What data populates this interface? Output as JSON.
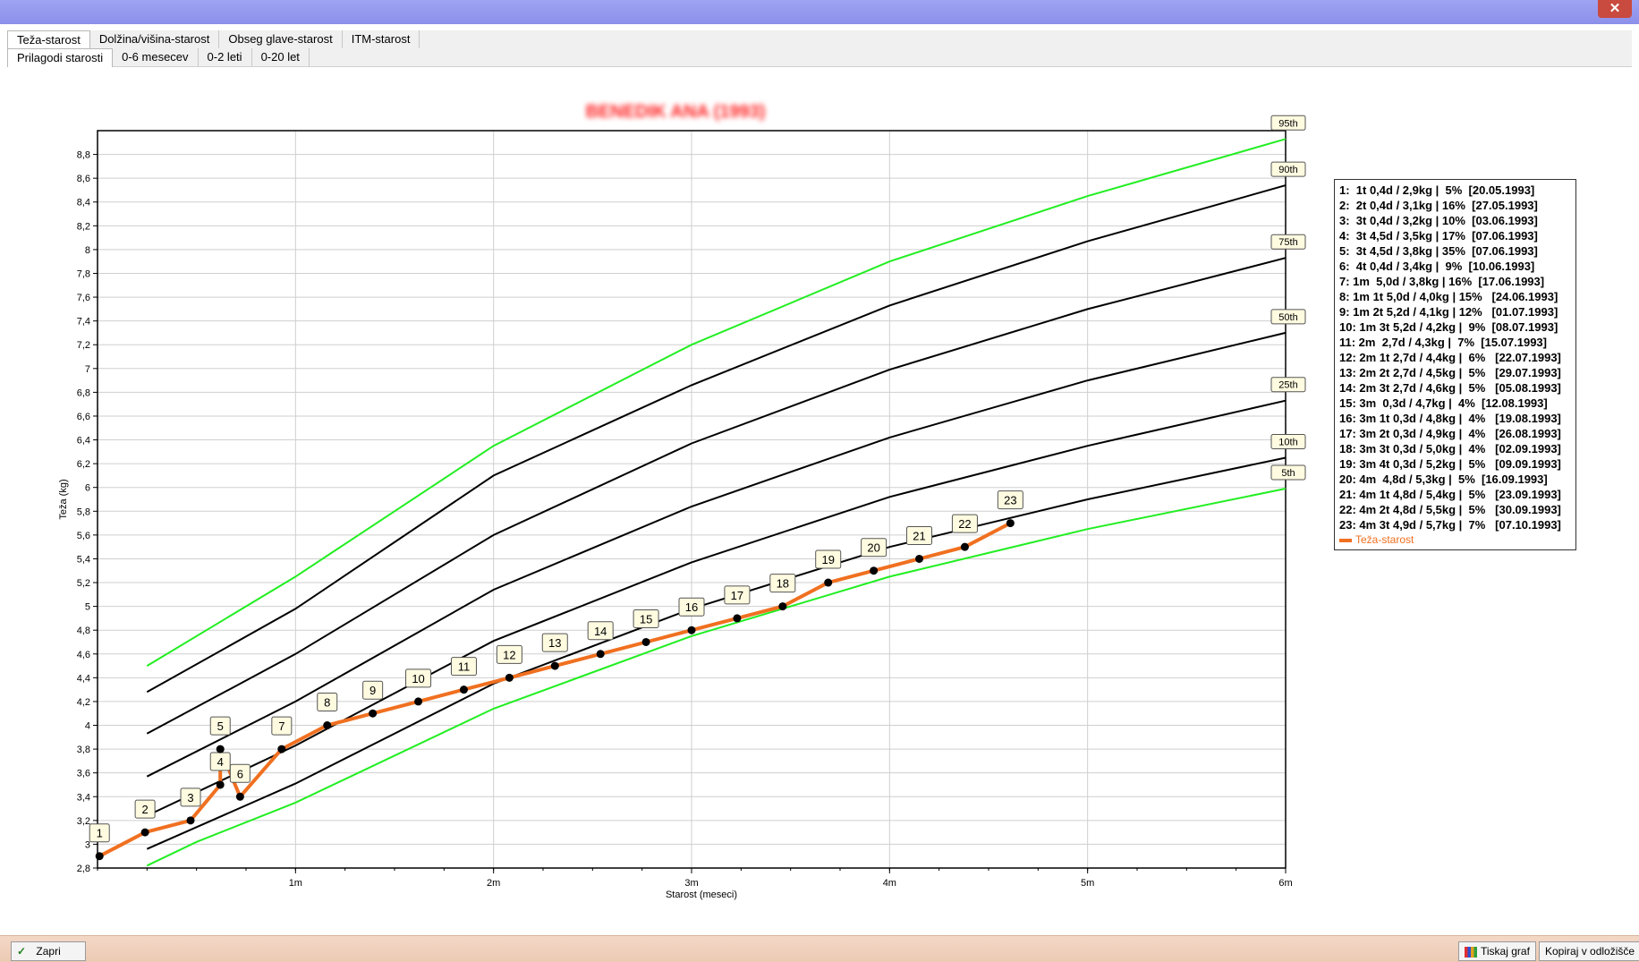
{
  "window": {
    "close_glyph": "✕"
  },
  "tabs_row1": [
    "Teža-starost",
    "Dolžina/višina-starost",
    "Obseg glave-starost",
    "ITM-starost"
  ],
  "tabs_row2": [
    "Prilagodi starosti",
    "0-6 mesecev",
    "0-2 leti",
    "0-20 let"
  ],
  "buttons": {
    "close": "Zapri",
    "print": "Tiskaj graf",
    "copy": "Kopiraj v odložišče"
  },
  "colors": {
    "series": "#f07020",
    "green_percentile": "#22ee22",
    "black_percentile": "#000000",
    "title": "#ff2020"
  },
  "chart_data": {
    "type": "line",
    "title": "BENEDIK ANA (1993)",
    "xlabel": "Starost (meseci)",
    "ylabel": "Teža (kg)",
    "xlim": [
      0,
      6
    ],
    "ylim": [
      2.8,
      9.0
    ],
    "x_tick_labels": [
      "1m",
      "2m",
      "3m",
      "4m",
      "5m",
      "6m"
    ],
    "x_ticks": [
      1,
      2,
      3,
      4,
      5,
      6
    ],
    "y_ticks": [
      2.8,
      3.0,
      3.2,
      3.4,
      3.6,
      3.8,
      4.0,
      4.2,
      4.4,
      4.6,
      4.8,
      5.0,
      5.2,
      5.4,
      5.6,
      5.8,
      6.0,
      6.2,
      6.4,
      6.6,
      6.8,
      7.0,
      7.2,
      7.4,
      7.6,
      7.8,
      8.0,
      8.2,
      8.4,
      8.6,
      8.8
    ],
    "y_tick_labels": [
      "2,8",
      "3",
      "3,2",
      "3,4",
      "3,6",
      "3,8",
      "4",
      "4,2",
      "4,4",
      "4,6",
      "4,8",
      "5",
      "5,2",
      "5,4",
      "5,6",
      "5,8",
      "6",
      "6,2",
      "6,4",
      "6,6",
      "6,8",
      "7",
      "7,2",
      "7,4",
      "7,6",
      "7,8",
      "8",
      "8,2",
      "8,4",
      "8,6",
      "8,8"
    ],
    "grid": true,
    "legend_position": "right",
    "percentiles": [
      {
        "name": "95th",
        "color": "#22ee22",
        "x": [
          0.25,
          1,
          2,
          3,
          4,
          5,
          6
        ],
        "y": [
          4.5,
          5.25,
          6.35,
          7.2,
          7.9,
          8.45,
          8.93
        ]
      },
      {
        "name": "90th",
        "color": "#000000",
        "x": [
          0.25,
          1,
          2,
          3,
          4,
          5,
          6
        ],
        "y": [
          4.28,
          4.98,
          6.1,
          6.86,
          7.53,
          8.07,
          8.54
        ]
      },
      {
        "name": "75th",
        "color": "#000000",
        "x": [
          0.25,
          1,
          2,
          3,
          4,
          5,
          6
        ],
        "y": [
          3.93,
          4.6,
          5.6,
          6.37,
          6.99,
          7.5,
          7.93
        ]
      },
      {
        "name": "50th",
        "color": "#000000",
        "x": [
          0.25,
          1,
          2,
          3,
          4,
          5,
          6
        ],
        "y": [
          3.57,
          4.2,
          5.14,
          5.84,
          6.42,
          6.9,
          7.3
        ]
      },
      {
        "name": "25th",
        "color": "#000000",
        "x": [
          0.25,
          1,
          2,
          3,
          4,
          5,
          6
        ],
        "y": [
          3.24,
          3.83,
          4.71,
          5.37,
          5.92,
          6.35,
          6.73
        ]
      },
      {
        "name": "10th",
        "color": "#000000",
        "x": [
          0.25,
          1,
          2,
          3,
          4,
          5,
          6
        ],
        "y": [
          2.96,
          3.51,
          4.35,
          4.98,
          5.5,
          5.9,
          6.25
        ]
      },
      {
        "name": "5th",
        "color": "#22ee22",
        "x": [
          0.25,
          0.5,
          1,
          2,
          3,
          4,
          5,
          6
        ],
        "y": [
          2.82,
          3.02,
          3.35,
          4.14,
          4.75,
          5.25,
          5.65,
          5.99
        ]
      }
    ],
    "series": [
      {
        "name": "Teža-starost",
        "color": "#f07020",
        "points": [
          {
            "label": "1",
            "x": 0.01,
            "y": 2.9
          },
          {
            "label": "2",
            "x": 0.24,
            "y": 3.1
          },
          {
            "label": "3",
            "x": 0.47,
            "y": 3.2
          },
          {
            "label": "4",
            "x": 0.62,
            "y": 3.5
          },
          {
            "label": "5",
            "x": 0.62,
            "y": 3.8
          },
          {
            "label": "6",
            "x": 0.72,
            "y": 3.4
          },
          {
            "label": "7",
            "x": 0.93,
            "y": 3.8
          },
          {
            "label": "8",
            "x": 1.16,
            "y": 4.0
          },
          {
            "label": "9",
            "x": 1.39,
            "y": 4.1
          },
          {
            "label": "10",
            "x": 1.62,
            "y": 4.2
          },
          {
            "label": "11",
            "x": 1.85,
            "y": 4.3
          },
          {
            "label": "12",
            "x": 2.08,
            "y": 4.4
          },
          {
            "label": "13",
            "x": 2.31,
            "y": 4.5
          },
          {
            "label": "14",
            "x": 2.54,
            "y": 4.6
          },
          {
            "label": "15",
            "x": 2.77,
            "y": 4.7
          },
          {
            "label": "16",
            "x": 3.0,
            "y": 4.8
          },
          {
            "label": "17",
            "x": 3.23,
            "y": 4.9
          },
          {
            "label": "18",
            "x": 3.46,
            "y": 5.0
          },
          {
            "label": "19",
            "x": 3.69,
            "y": 5.2
          },
          {
            "label": "20",
            "x": 3.92,
            "y": 5.3
          },
          {
            "label": "21",
            "x": 4.15,
            "y": 5.4
          },
          {
            "label": "22",
            "x": 4.38,
            "y": 5.5
          },
          {
            "label": "23",
            "x": 4.61,
            "y": 5.7
          }
        ]
      }
    ],
    "legend_entries": [
      "1:  1t 0,4d / 2,9kg |  5%  [20.05.1993]",
      "2:  2t 0,4d / 3,1kg | 16%  [27.05.1993]",
      "3:  3t 0,4d / 3,2kg | 10%  [03.06.1993]",
      "4:  3t 4,5d / 3,5kg | 17%  [07.06.1993]",
      "5:  3t 4,5d / 3,8kg | 35%  [07.06.1993]",
      "6:  4t 0,4d / 3,4kg |  9%  [10.06.1993]",
      "7: 1m  5,0d / 3,8kg | 16%  [17.06.1993]",
      "8: 1m 1t 5,0d / 4,0kg | 15%   [24.06.1993]",
      "9: 1m 2t 5,2d / 4,1kg | 12%   [01.07.1993]",
      "10: 1m 3t 5,2d / 4,2kg |  9%  [08.07.1993]",
      "11: 2m  2,7d / 4,3kg |  7%  [15.07.1993]",
      "12: 2m 1t 2,7d / 4,4kg |  6%   [22.07.1993]",
      "13: 2m 2t 2,7d / 4,5kg |  5%   [29.07.1993]",
      "14: 2m 3t 2,7d / 4,6kg |  5%   [05.08.1993]",
      "15: 3m  0,3d / 4,7kg |  4%  [12.08.1993]",
      "16: 3m 1t 0,3d / 4,8kg |  4%   [19.08.1993]",
      "17: 3m 2t 0,3d / 4,9kg |  4%   [26.08.1993]",
      "18: 3m 3t 0,3d / 5,0kg |  4%   [02.09.1993]",
      "19: 3m 4t 0,3d / 5,2kg |  5%   [09.09.1993]",
      "20: 4m  4,8d / 5,3kg |  5%  [16.09.1993]",
      "21: 4m 1t 4,8d / 5,4kg |  5%   [23.09.1993]",
      "22: 4m 2t 4,8d / 5,5kg |  5%   [30.09.1993]",
      "23: 4m 3t 4,9d / 5,7kg |  7%   [07.10.1993]"
    ]
  }
}
